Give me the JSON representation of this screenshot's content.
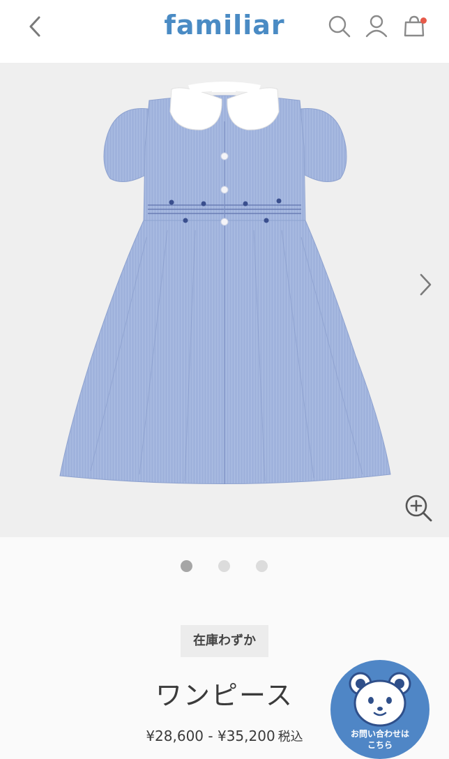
{
  "header": {
    "logo": "familiar",
    "icons": [
      "back-arrow-icon",
      "search-icon",
      "user-icon",
      "cart-icon"
    ],
    "accent_color": "#4a8bc4",
    "cart_badge_color": "#e65a4a"
  },
  "gallery": {
    "image_alt_icon": "dress-image",
    "slide_count": 3,
    "active_slide": 1
  },
  "product": {
    "stock_status": "在庫わずか",
    "name": "ワンピース",
    "price_range": "¥28,600 - ¥35,200",
    "tax_label": "税込"
  },
  "contact": {
    "label_line1": "お問い合わせは",
    "label_line2": "こちら",
    "color": "#4f86c6"
  }
}
